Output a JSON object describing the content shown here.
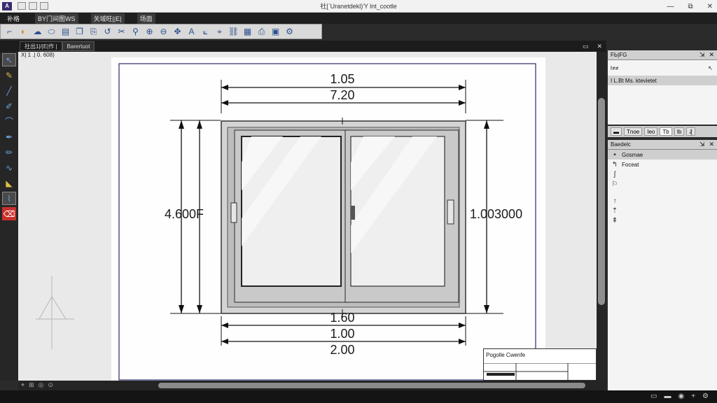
{
  "window": {
    "title": "社[ˊUranetdekl)'Y lnt_cootle",
    "controls": [
      "—",
      "⧉",
      "✕"
    ]
  },
  "menu": {
    "items": [
      "补格",
      "BY门间图WS",
      "关域旺||E|",
      "场面"
    ]
  },
  "document": {
    "tab_label": "社出1|/|E|作 |",
    "tab2_label": "Barertuot",
    "coordinates": "X|  1  .|  0.  608)",
    "tab_controls": [
      "▭",
      "✕"
    ]
  },
  "drawing": {
    "dim_top_1": "1.05",
    "dim_top_2": "7.20",
    "dim_left": "4.600F",
    "dim_right": "1.003000",
    "dim_bottom_1": "1.60",
    "dim_bottom_2": "1.00",
    "dim_bottom_3": "2.00"
  },
  "title_block": {
    "name": "Pogolle Cwenfe"
  },
  "panels": {
    "top": {
      "title": "FЬ|FG",
      "row1": "ŀ≠≠",
      "row2": "I  L.Bt  Ms. ktevietet"
    },
    "tabs": [
      "▬",
      "Tnoe",
      "Ieo",
      "Tb",
      "Ib",
      "₰"
    ],
    "bottom": {
      "title": "Baedelc",
      "row1": "Gosmae",
      "row2": "Foceat"
    }
  },
  "colors": {
    "accent": "#2c4f8f",
    "highlight_tool": "#c9302c",
    "frame_gray": "#8a8a8a"
  }
}
